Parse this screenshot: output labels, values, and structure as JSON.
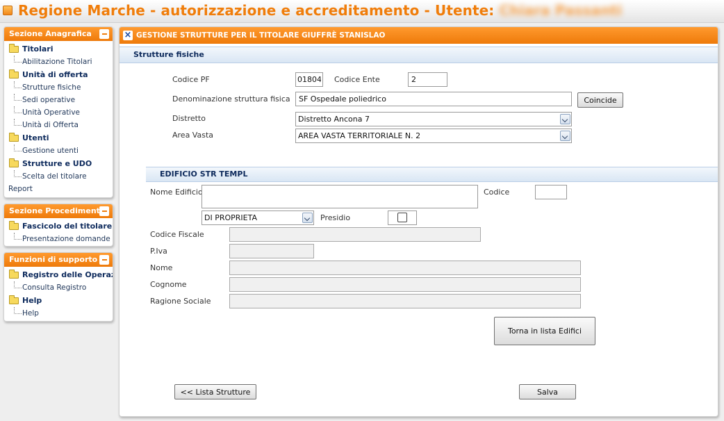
{
  "header": {
    "title": "Regione Marche - autorizzazione e accreditamento - Utente:",
    "user": "Chiara Passanti"
  },
  "sidebar": {
    "anagrafica": {
      "title": "Sezione Anagrafica",
      "groups": [
        {
          "label": "Titolari",
          "items": [
            "Abilitazione Titolari"
          ]
        },
        {
          "label": "Unità di offerta",
          "items": [
            "Strutture fisiche",
            "Sedi operative",
            "Unità Operative",
            "Unità di Offerta"
          ]
        },
        {
          "label": "Utenti",
          "items": [
            "Gestione utenti"
          ]
        },
        {
          "label": "Strutture e UDO",
          "items": [
            "Scelta del titolare"
          ]
        }
      ],
      "root_item": "Report"
    },
    "procedimenti": {
      "title": "Sezione Procedimenti",
      "groups": [
        {
          "label": "Fascicolo del titolare",
          "items": [
            "Presentazione domande"
          ]
        }
      ]
    },
    "supporto": {
      "title": "Funzioni di supporto",
      "groups": [
        {
          "label": "Registro delle Operazioni",
          "items": [
            "Consulta Registro"
          ]
        },
        {
          "label": "Help",
          "items": [
            "Help"
          ]
        }
      ]
    }
  },
  "main": {
    "title": "GESTIONE STRUTTURE PER IL TITOLARE GIUFFRÈ STANISLAO",
    "section_fisiche": "Strutture fisiche",
    "codice_pf": {
      "label": "Codice PF",
      "value": "01804"
    },
    "codice_ente": {
      "label": "Codice Ente",
      "value": "2"
    },
    "denominazione": {
      "label": "Denominazione struttura fisica",
      "value": "SF Ospedale poliedrico"
    },
    "coincide_button": "Coincide",
    "distretto": {
      "label": "Distretto",
      "value": "Distretto Ancona 7"
    },
    "area_vasta": {
      "label": "Area Vasta",
      "value": "AREA VASTA TERRITORIALE N. 2"
    },
    "section_edificio": "EDIFICIO STR TEMPL",
    "nome_edificio": {
      "label": "Nome Edificio",
      "value": ""
    },
    "codice": {
      "label": "Codice",
      "value": ""
    },
    "proprieta": {
      "value": "DI PROPRIETA"
    },
    "presidio": {
      "label": "Presidio",
      "checked": false
    },
    "codice_fiscale": {
      "label": "Codice Fiscale",
      "value": ""
    },
    "piva": {
      "label": "P.Iva",
      "value": ""
    },
    "nome": {
      "label": "Nome",
      "value": ""
    },
    "cognome": {
      "label": "Cognome",
      "value": ""
    },
    "ragione_sociale": {
      "label": "Ragione Sociale",
      "value": ""
    },
    "torna_button": "Torna in lista Edifici",
    "lista_button": "<< Lista Strutture",
    "salva_button": "Salva"
  }
}
